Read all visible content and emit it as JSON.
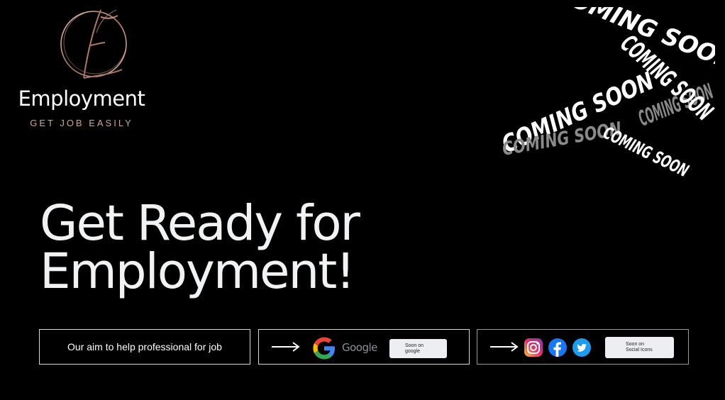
{
  "brand": {
    "name": "Employment",
    "tagline": "GET JOB EASILY",
    "accent_color": "#d3a592"
  },
  "coming_soon": {
    "text": "COMING SOON",
    "icon": "coming-soon-ribbon-graphic"
  },
  "headline": {
    "line1": "Get Ready for",
    "line2": "Employment!"
  },
  "features": {
    "aim": "Our aim to help professional for job",
    "google": {
      "label": "Google",
      "pill_line1": "Soon on",
      "pill_line2": "google"
    },
    "social": {
      "pill_line1": "Soon on",
      "pill_line2": "Social Icons",
      "icons": [
        "instagram-icon",
        "facebook-icon",
        "twitter-icon"
      ]
    }
  },
  "colors": {
    "background": "#000000",
    "instagram": "#e1306c",
    "facebook": "#1877f2",
    "twitter": "#1d9bf0"
  }
}
